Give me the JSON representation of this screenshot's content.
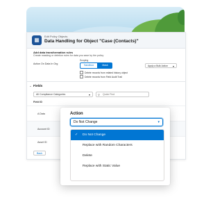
{
  "header": {
    "breadcrumb": "Edit Policy Objects",
    "title": "Data Handling for Object \"Case (Contacts)\"",
    "icon": "policy-icon"
  },
  "rules": {
    "section_title": "Add data transformation rules",
    "section_subtitle": "Create masking or deletion rules for data you save by the policy",
    "action_label": "Action On Data In Org",
    "scope_label": "Scoping",
    "toggle": [
      "Sandbox",
      "Mask"
    ],
    "active_toggle": "Mask",
    "bulk_action": "Apply a Bulk Action",
    "checkbox_1": "Delete records from related history object",
    "checkbox_2": "Delete records from Field Audit Trail"
  },
  "fields": {
    "title": "Fields",
    "category_select": "All Compliance Categories",
    "quick_find_placeholder": "Quick Find",
    "column_header": "Field ID",
    "rows": [
      "A Data",
      "Account ID",
      "Asset ID"
    ],
    "back_label": "Back"
  },
  "popup": {
    "title": "Action",
    "selected_value": "Do Not Change",
    "options": [
      "Do Not Change",
      "Replace with Random Characters",
      "Delete",
      "Replace with Static Value"
    ],
    "selected_index": 0
  },
  "colors": {
    "accent": "#0176d3",
    "header_icon": "#1b5297"
  }
}
